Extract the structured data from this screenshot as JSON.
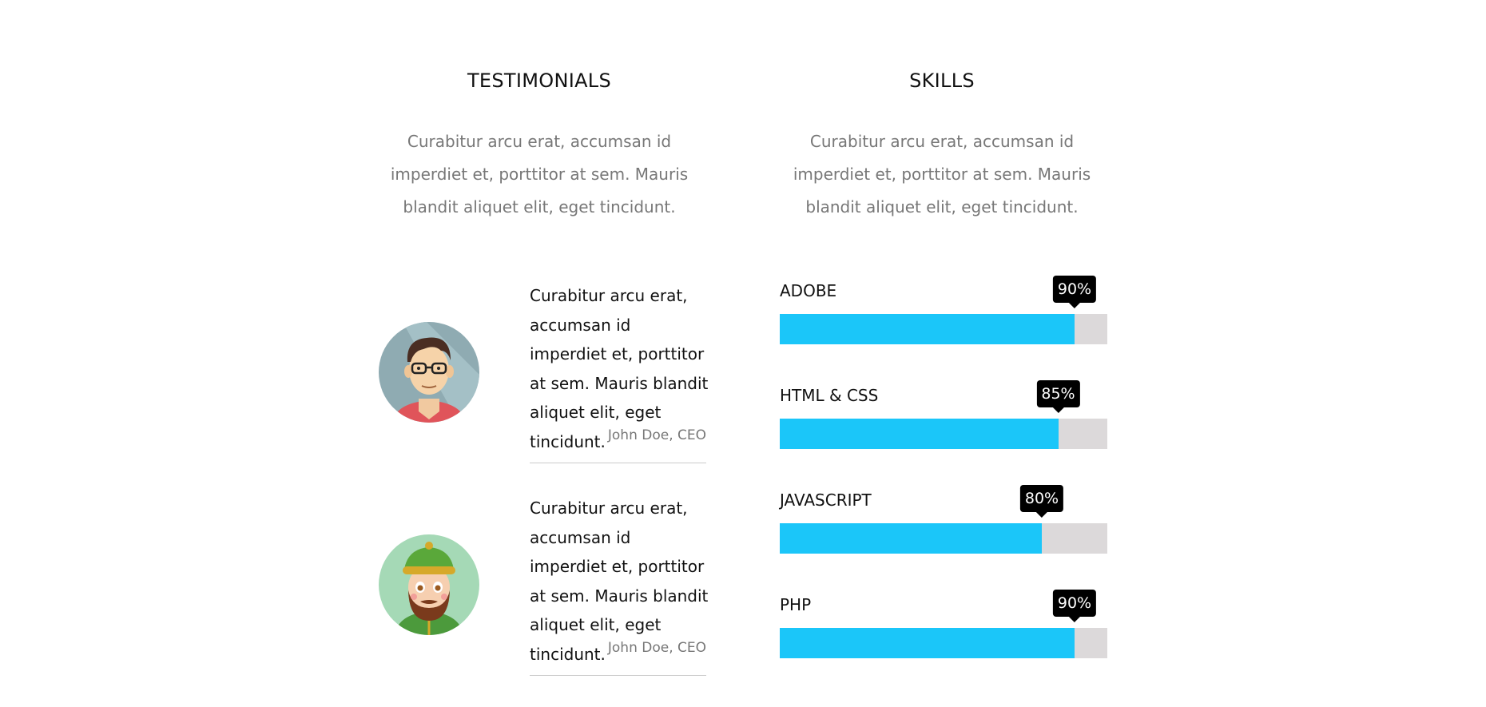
{
  "testimonials": {
    "title": "TESTIMONIALS",
    "description": "Curabitur arcu erat, accumsan id imperdiet et, porttitor at sem. Mauris blandit aliquet elit, eget tincidunt.",
    "items": [
      {
        "avatar_icon": "man-with-glasses-avatar-icon",
        "quote": "Curabitur arcu erat, accumsan id imperdiet et, porttitor at sem. Mauris blandit aliquet elit, eget tincidunt.",
        "author": "John Doe, CEO"
      },
      {
        "avatar_icon": "bearded-man-with-hat-avatar-icon",
        "quote": "Curabitur arcu erat, accumsan id imperdiet et, porttitor at sem. Mauris blandit aliquet elit, eget tincidunt.",
        "author": "John Doe, CEO"
      }
    ]
  },
  "skills": {
    "title": "SKILLS",
    "description": "Curabitur arcu erat, accumsan id imperdiet et, porttitor at sem. Mauris blandit aliquet elit, eget tincidunt.",
    "fill_color": "#1bc6f9",
    "track_color": "#dcd9da",
    "items": [
      {
        "label": "ADOBE",
        "percent": 90,
        "percent_label": "90%"
      },
      {
        "label": "HTML & CSS",
        "percent": 85,
        "percent_label": "85%"
      },
      {
        "label": "JAVASCRIPT",
        "percent": 80,
        "percent_label": "80%"
      },
      {
        "label": "PHP",
        "percent": 90,
        "percent_label": "90%"
      }
    ]
  }
}
